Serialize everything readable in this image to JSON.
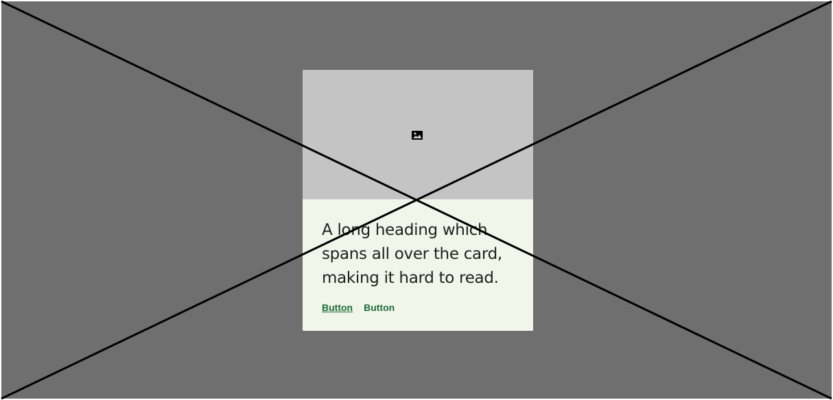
{
  "card": {
    "heading": "A long heading which spans all over the card, making it hard to read.",
    "media_icon": "image-icon",
    "buttons": [
      {
        "label": "Button"
      },
      {
        "label": "Button"
      }
    ]
  },
  "colors": {
    "backdrop": "#6f6f6f",
    "media_placeholder": "#c4c4c4",
    "card_background": "#f1f6ea",
    "button_text": "#1d6b3a",
    "heading_text": "#1f1f1f",
    "overlay_lines": "#000000"
  },
  "overlay": {
    "type": "placeholder-cross",
    "icon": "cross-lines"
  }
}
